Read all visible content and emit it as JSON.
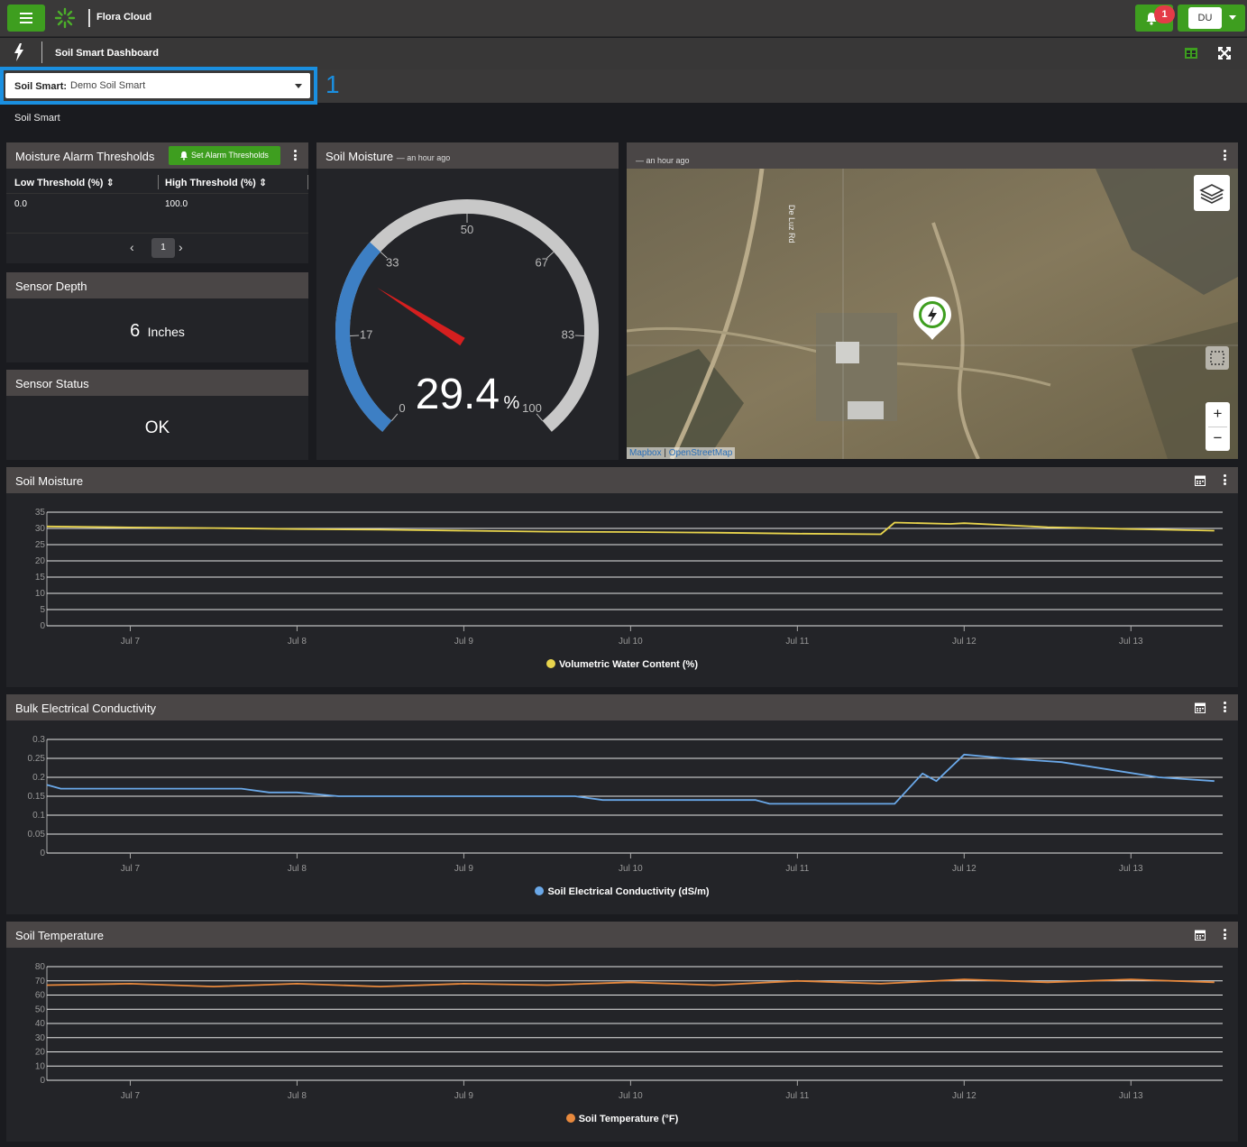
{
  "topbar": {
    "brand": "Flora Cloud",
    "notifications_count": "1",
    "user_initials": "DU"
  },
  "dashboard": {
    "title": "Soil Smart Dashboard"
  },
  "selector": {
    "label": "Soil Smart:",
    "value": "Demo Soil Smart",
    "callout_number": "1"
  },
  "breadcrumb": "Soil Smart",
  "alarm_panel": {
    "title": "Moisture Alarm Thresholds",
    "button_label": "Set Alarm Thresholds",
    "columns": [
      "Low Threshold (%)",
      "High Threshold (%)"
    ],
    "rows": [
      [
        "0.0",
        "100.0"
      ]
    ],
    "page": "1"
  },
  "depth_panel": {
    "title": "Sensor Depth",
    "value": "6",
    "unit": "Inches"
  },
  "status_panel": {
    "title": "Sensor Status",
    "value": "OK"
  },
  "gauge_panel": {
    "title": "Soil Moisture",
    "subtitle": "— an hour ago",
    "value": "29.4",
    "unit": "%",
    "ticks": [
      "0",
      "17",
      "33",
      "50",
      "67",
      "83",
      "100"
    ],
    "colors": {
      "band": "#3d7fc4",
      "track": "#c8c8c8",
      "needle": "#d51f1f"
    }
  },
  "map_panel": {
    "subtitle": "— an hour ago",
    "road_label": "De Luz Rd",
    "attribution": [
      "Mapbox",
      "OpenStreetMap"
    ],
    "zoom_in": "+",
    "zoom_out": "−"
  },
  "chart_data": [
    {
      "type": "line",
      "title": "Soil Moisture",
      "x": [
        "Jul 6 12:00",
        "Jul 7",
        "Jul 7 12:00",
        "Jul 8",
        "Jul 8 12:00",
        "Jul 9",
        "Jul 9 12:00",
        "Jul 10",
        "Jul 10 12:00",
        "Jul 11",
        "Jul 11 12:00",
        "Jul 11 14:00",
        "Jul 11 22:00",
        "Jul 12",
        "Jul 12 12:00",
        "Jul 13",
        "Jul 13 12:00"
      ],
      "series": [
        {
          "name": "Volumetric Water Content (%)",
          "color": "#e8d44d",
          "values": [
            30.6,
            30.3,
            30.1,
            29.8,
            29.6,
            29.3,
            29.0,
            28.9,
            28.7,
            28.4,
            28.2,
            31.8,
            31.4,
            31.6,
            30.4,
            29.8,
            29.3
          ]
        }
      ],
      "ylim": [
        0,
        35
      ],
      "yticks": [
        "0",
        "5",
        "10",
        "15",
        "20",
        "25",
        "30",
        "35"
      ],
      "xtick_labels": [
        "Jul 7",
        "Jul 8",
        "Jul 9",
        "Jul 10",
        "Jul 11",
        "Jul 12",
        "Jul 13"
      ],
      "grid": true,
      "legend": "bottom"
    },
    {
      "type": "line",
      "title": "Bulk Electrical Conductivity",
      "x": [
        "Jul 6 12:00",
        "Jul 6 14:00",
        "Jul 7 16:00",
        "Jul 7 20:00",
        "Jul 8",
        "Jul 8 06:00",
        "Jul 9 16:00",
        "Jul 9 20:00",
        "Jul 10 18:00",
        "Jul 10 20:00",
        "Jul 11 14:00",
        "Jul 11 18:00",
        "Jul 11 20:00",
        "Jul 12",
        "Jul 12 06:00",
        "Jul 12 14:00",
        "Jul 13 04:00",
        "Jul 13 12:00"
      ],
      "series": [
        {
          "name": "Soil Electrical Conductivity (dS/m)",
          "color": "#6aa8e8",
          "values": [
            0.18,
            0.17,
            0.17,
            0.16,
            0.16,
            0.15,
            0.15,
            0.14,
            0.14,
            0.13,
            0.13,
            0.21,
            0.19,
            0.26,
            0.25,
            0.24,
            0.2,
            0.19
          ]
        }
      ],
      "ylim": [
        0,
        0.3
      ],
      "yticks": [
        "0",
        "0.05",
        "0.1",
        "0.15",
        "0.2",
        "0.25",
        "0.3"
      ],
      "xtick_labels": [
        "Jul 7",
        "Jul 8",
        "Jul 9",
        "Jul 10",
        "Jul 11",
        "Jul 12",
        "Jul 13"
      ],
      "grid": true,
      "legend": "bottom"
    },
    {
      "type": "line",
      "title": "Soil Temperature",
      "x": [
        "Jul 6 12:00",
        "Jul 7",
        "Jul 7 12:00",
        "Jul 8",
        "Jul 8 12:00",
        "Jul 9",
        "Jul 9 12:00",
        "Jul 10",
        "Jul 10 12:00",
        "Jul 11",
        "Jul 11 12:00",
        "Jul 12",
        "Jul 12 12:00",
        "Jul 13",
        "Jul 13 12:00"
      ],
      "series": [
        {
          "name": "Soil Temperature (°F)",
          "color": "#e8893d",
          "values": [
            67,
            68,
            66,
            68,
            66,
            68,
            67,
            69,
            67,
            70,
            68,
            71,
            69,
            71,
            69
          ]
        }
      ],
      "ylim": [
        0,
        80
      ],
      "yticks": [
        "0",
        "10",
        "20",
        "30",
        "40",
        "50",
        "60",
        "70",
        "80"
      ],
      "xtick_labels": [
        "Jul 7",
        "Jul 8",
        "Jul 9",
        "Jul 10",
        "Jul 11",
        "Jul 12",
        "Jul 13"
      ],
      "grid": true,
      "legend": "bottom"
    }
  ]
}
